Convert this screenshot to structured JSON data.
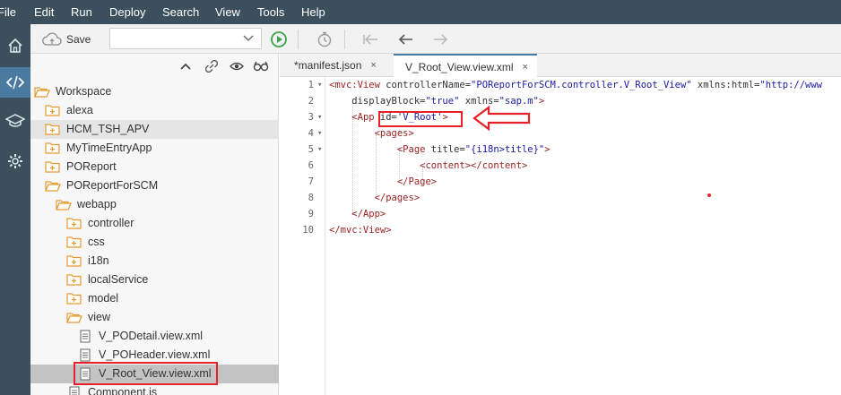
{
  "menu": [
    "File",
    "Edit",
    "Run",
    "Deploy",
    "Search",
    "View",
    "Tools",
    "Help"
  ],
  "toolbar": {
    "save_label": "Save",
    "run_config_value": ""
  },
  "tree": {
    "items": [
      {
        "label": "Workspace",
        "icon": "folder-open-icon"
      },
      {
        "label": "alexa",
        "icon": "project-folder-icon"
      },
      {
        "label": "HCM_TSH_APV",
        "icon": "project-folder-icon"
      },
      {
        "label": "MyTimeEntryApp",
        "icon": "project-folder-icon"
      },
      {
        "label": "POReport",
        "icon": "project-folder-icon"
      },
      {
        "label": "POReportForSCM",
        "icon": "folder-open-icon"
      },
      {
        "label": "webapp",
        "icon": "folder-open-icon"
      },
      {
        "label": "controller",
        "icon": "project-folder-icon"
      },
      {
        "label": "css",
        "icon": "project-folder-icon"
      },
      {
        "label": "i18n",
        "icon": "project-folder-icon"
      },
      {
        "label": "localService",
        "icon": "project-folder-icon"
      },
      {
        "label": "model",
        "icon": "project-folder-icon"
      },
      {
        "label": "view",
        "icon": "folder-open-icon"
      },
      {
        "label": "V_PODetail.view.xml",
        "icon": "file-icon"
      },
      {
        "label": "V_POHeader.view.xml",
        "icon": "file-icon"
      },
      {
        "label": "V_Root_View.view.xml",
        "icon": "file-icon"
      },
      {
        "label": "Component.js",
        "icon": "file-icon"
      }
    ]
  },
  "tabs": [
    {
      "label": "*manifest.json",
      "close": "×"
    },
    {
      "label": "V_Root_View.view.xml",
      "close": "×"
    }
  ],
  "code": {
    "line_numbers": [
      "1",
      "2",
      "3",
      "4",
      "5",
      "6",
      "7",
      "8",
      "9",
      "10"
    ],
    "lines": [
      [
        [
          "tag",
          "<mvc:View "
        ],
        [
          "att",
          "controllerName="
        ],
        [
          "str",
          "\"POReportForSCM.controller.V_Root_View\""
        ],
        [
          "att",
          " xmlns:html="
        ],
        [
          "str",
          "\"http://www"
        ]
      ],
      [
        [
          "att",
          "    displayBlock="
        ],
        [
          "str",
          "\"true\""
        ],
        [
          "att",
          " xmlns="
        ],
        [
          "str",
          "\"sap.m\""
        ],
        [
          "tag",
          ">"
        ]
      ],
      [
        [
          "att",
          "    "
        ],
        [
          "tag",
          "<App "
        ],
        [
          "att",
          "id="
        ],
        [
          "str",
          "'V_Root'"
        ],
        [
          "tag",
          ">"
        ]
      ],
      [
        [
          "att",
          "        "
        ],
        [
          "tag",
          "<pages>"
        ]
      ],
      [
        [
          "att",
          "            "
        ],
        [
          "tag",
          "<Page "
        ],
        [
          "att",
          "title="
        ],
        [
          "str",
          "\"{i18n>title}\""
        ],
        [
          "tag",
          ">"
        ]
      ],
      [
        [
          "att",
          "                "
        ],
        [
          "tag",
          "<content></content>"
        ]
      ],
      [
        [
          "att",
          "            "
        ],
        [
          "tag",
          "</Page>"
        ]
      ],
      [
        [
          "att",
          "        "
        ],
        [
          "tag",
          "</pages>"
        ]
      ],
      [
        [
          "att",
          "    "
        ],
        [
          "tag",
          "</App>"
        ]
      ],
      [
        [
          "tag",
          "</mvc:View>"
        ]
      ]
    ]
  },
  "colors": {
    "menubar": "#3b4f5c",
    "annotation_red": "#e8202a",
    "run_green": "#3aa64a",
    "folder_orange": "#e59a2e",
    "xml_tag": "#9b1f1f",
    "xml_string": "#1a1aa6"
  }
}
